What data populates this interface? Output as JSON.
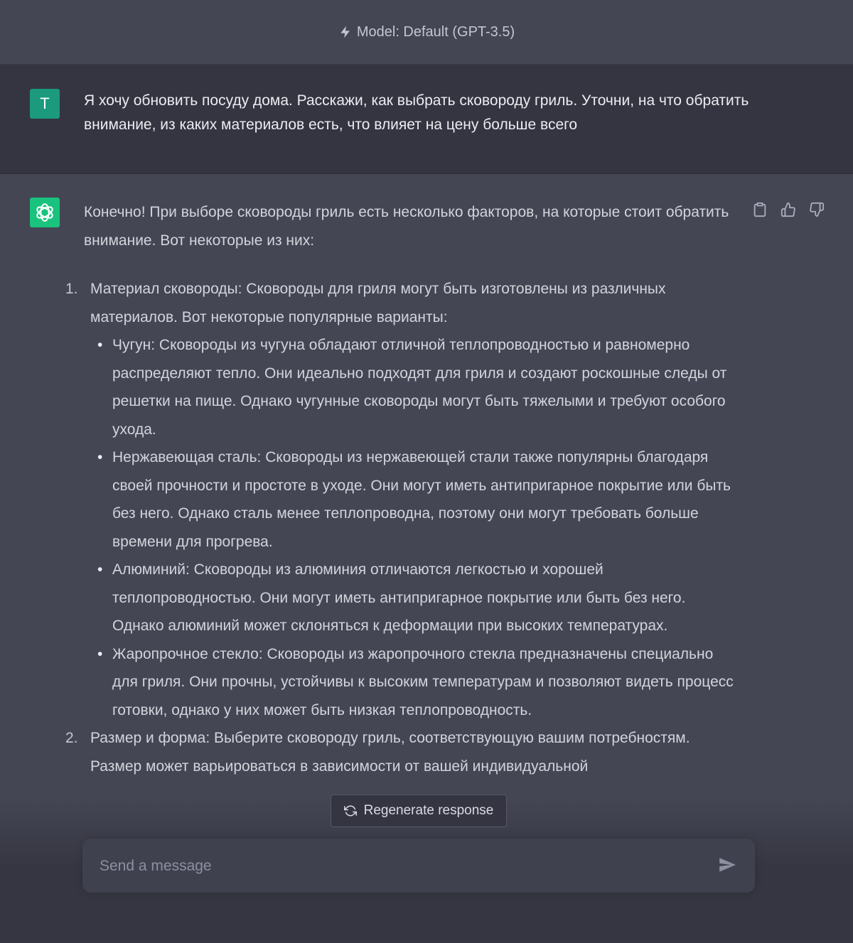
{
  "header": {
    "model_label": "Model: Default (GPT-3.5)",
    "icon": "bolt-icon"
  },
  "user_message": {
    "avatar_letter": "T",
    "text": "Я хочу обновить посуду дома. Расскажи, как выбрать сковороду гриль. Уточни, на что обратить внимание, из каких материалов есть, что влияет на цену больше всего"
  },
  "assistant_message": {
    "intro": "Конечно! При выборе сковороды гриль есть несколько факторов, на которые стоит обратить внимание. Вот некоторые из них:",
    "items": [
      {
        "num": "1.",
        "text": "Материал сковороды: Сковороды для гриля могут быть изготовлены из различных материалов. Вот некоторые популярные варианты:",
        "subitems": [
          "Чугун: Сковороды из чугуна обладают отличной теплопроводностью и равномерно распределяют тепло. Они идеально подходят для гриля и создают роскошные следы от решетки на пище. Однако чугунные сковороды могут быть тяжелыми и требуют особого ухода.",
          "Нержавеющая сталь: Сковороды из нержавеющей стали также популярны благодаря своей прочности и простоте в уходе. Они могут иметь антипригарное покрытие или быть без него. Однако сталь менее теплопроводна, поэтому они могут требовать больше времени для прогрева.",
          "Алюминий: Сковороды из алюминия отличаются легкостью и хорошей теплопроводностью. Они могут иметь антипригарное покрытие или быть без него. Однако алюминий может склоняться к деформации при высоких температурах.",
          "Жаропрочное стекло: Сковороды из жаропрочного стекла предназначены специально для гриля. Они прочны, устойчивы к высоким температурам и позволяют видеть процесс готовки, однако у них может быть низкая теплопроводность."
        ]
      },
      {
        "num": "2.",
        "text": "Размер и форма: Выберите сковороду гриль, соответствующую вашим потребностям. Размер может варьироваться в зависимости от вашей индивидуальной"
      }
    ]
  },
  "actions": {
    "copy": "clipboard-icon",
    "like": "thumbs-up-icon",
    "dislike": "thumbs-down-icon"
  },
  "regenerate": {
    "label": "Regenerate response"
  },
  "composer": {
    "placeholder": "Send a message"
  },
  "colors": {
    "background": "#444654",
    "user_row": "#343541",
    "user_avatar": "#1c9a7e",
    "bot_avatar": "#19c37d",
    "composer": "#40414f"
  }
}
